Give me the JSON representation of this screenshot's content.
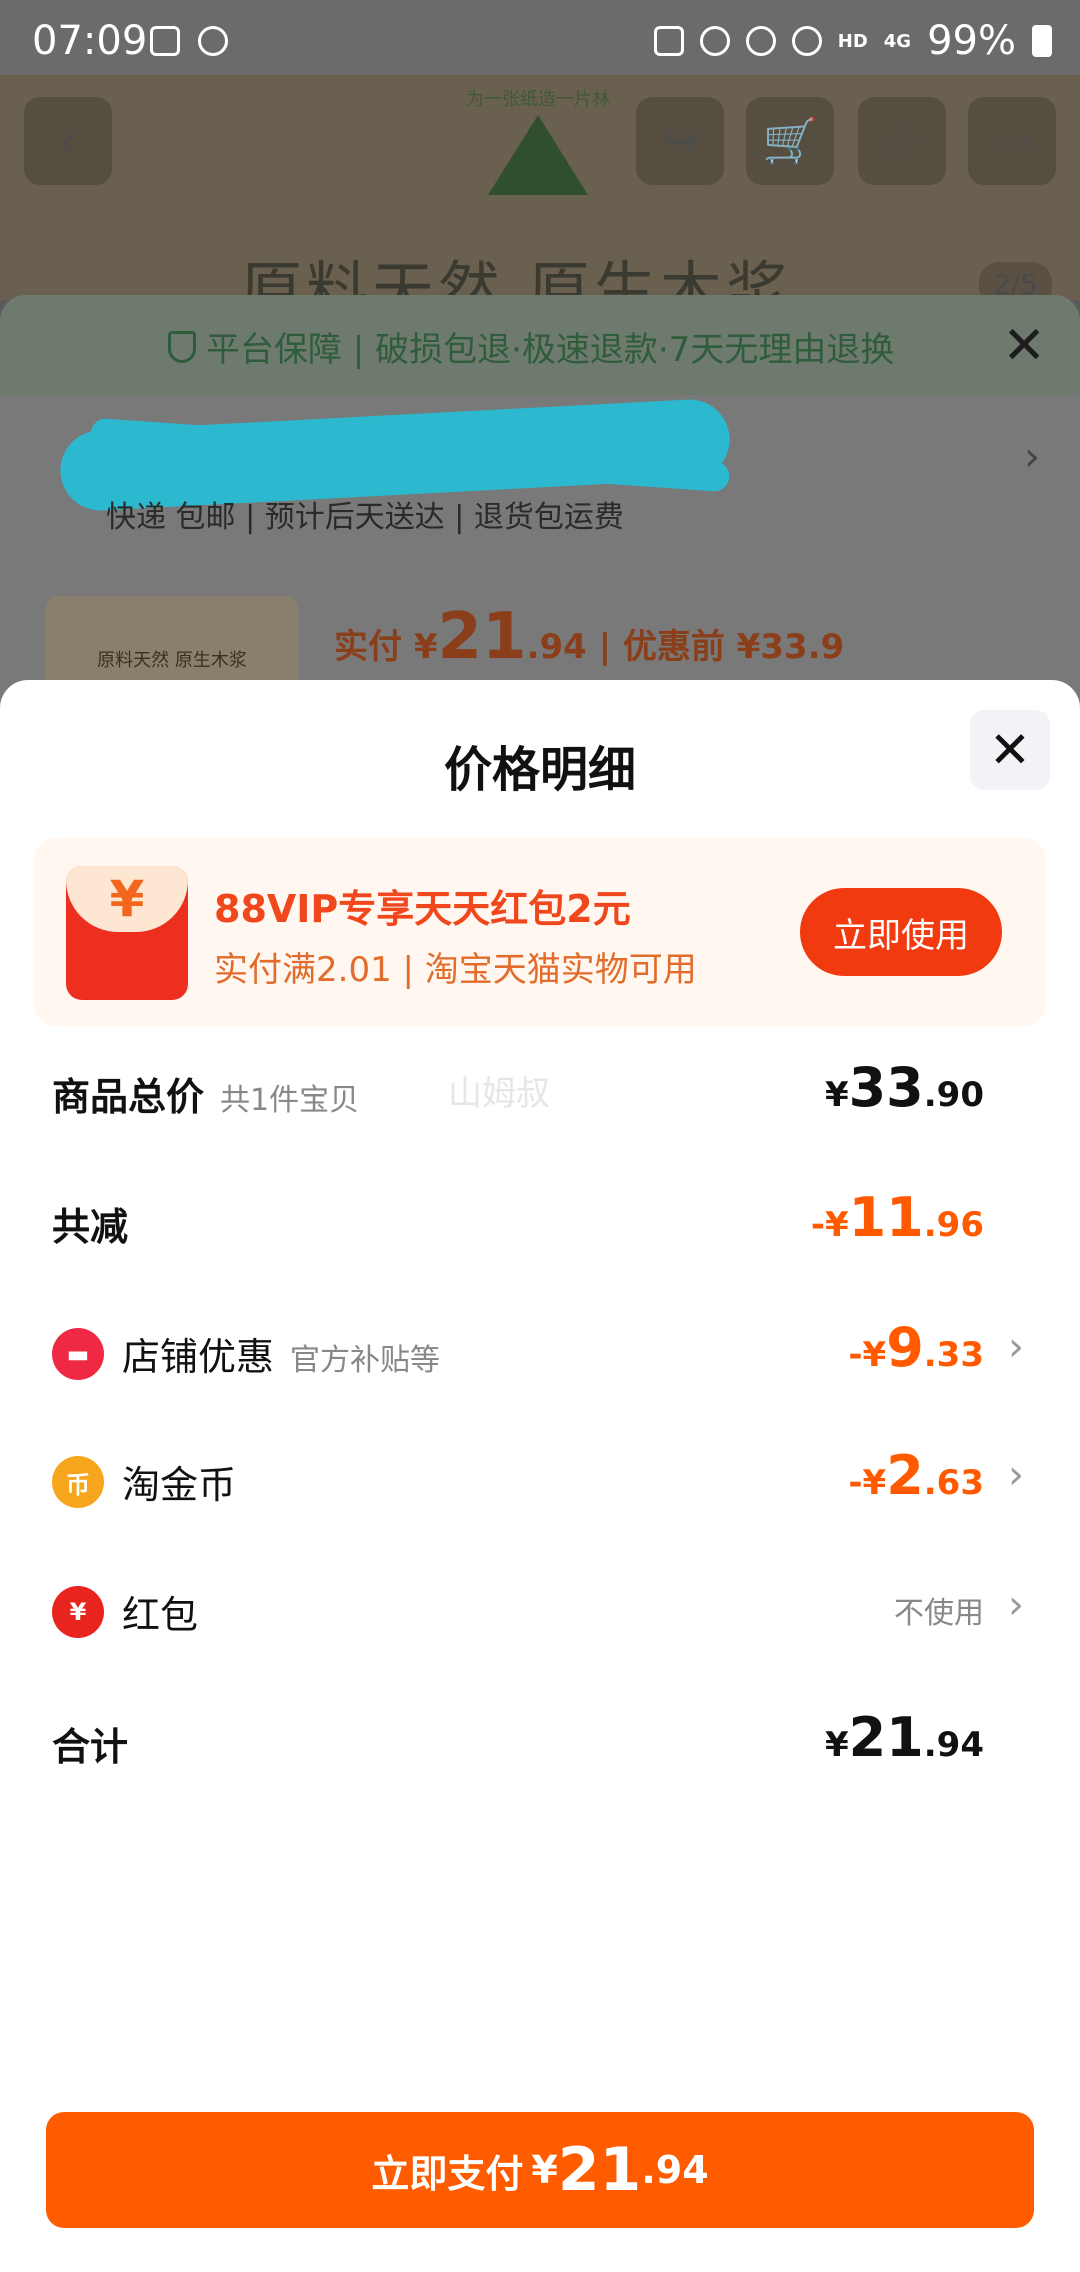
{
  "status_bar": {
    "time": "07:09",
    "network": "HD",
    "network_gen": "4G",
    "battery": "99%"
  },
  "background": {
    "brand_ring_text": "为一张纸造一片林",
    "product_title": "原料天然 原生木浆",
    "pager": "2/5",
    "guarantee": "平台保障 | 破损包退·极速退款·7天无理由退换",
    "delivery": "快递 包邮 | 预计后天送达 | 退货包运费",
    "thumb_text": "原料天然 原生木浆",
    "price_prefix": "实付 ¥",
    "price_int": "21",
    "price_dec": ".94",
    "price_before": "| 优惠前 ¥33.9"
  },
  "sheet": {
    "title": "价格明细",
    "promo": {
      "title": "88VIP专享天天红包2元",
      "subtitle": "实付满2.01 | 淘宝天猫实物可用",
      "button": "立即使用",
      "envelope_symbol": "¥"
    },
    "watermark": "山姆叔",
    "rows": {
      "total": {
        "label": "商品总价",
        "note": "共1件宝贝",
        "currency": "¥",
        "int": "33",
        "dec": ".90"
      },
      "reduction": {
        "label": "共减",
        "currency": "-¥",
        "int": "11",
        "dec": ".96"
      },
      "shop": {
        "label": "店铺优惠",
        "note": "官方补贴等",
        "currency": "-¥",
        "int": "9",
        "dec": ".33"
      },
      "coins": {
        "label": "淘金币",
        "currency": "-¥",
        "int": "2",
        "dec": ".63",
        "icon_text": "币"
      },
      "redpacket": {
        "label": "红包",
        "value": "不使用",
        "icon_text": "¥"
      },
      "sum": {
        "label": "合计",
        "currency": "¥",
        "int": "21",
        "dec": ".94"
      }
    },
    "pay_button": {
      "label": "立即支付",
      "currency": "¥",
      "int": "21",
      "dec": ".94"
    }
  },
  "colors": {
    "accent": "#ff5c00",
    "promo_red": "#f23a10",
    "discount_orange": "#ff5a00"
  }
}
